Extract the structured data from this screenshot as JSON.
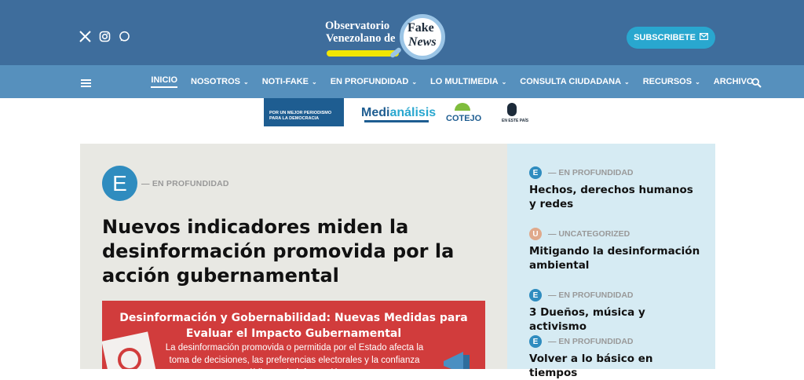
{
  "header": {
    "social": [
      "x-icon",
      "instagram-icon",
      "whatsapp-icon"
    ],
    "logo": {
      "line1": "Observatorio",
      "line2": "Venezolano de",
      "fake": "Fake",
      "news": "News"
    },
    "subscribe_label": "SUBSCRIBETE"
  },
  "nav": {
    "items": [
      {
        "label": "INICIO",
        "dropdown": false
      },
      {
        "label": "NOSOTROS",
        "dropdown": true
      },
      {
        "label": "NOTI-FAKE",
        "dropdown": true
      },
      {
        "label": "EN PROFUNDIDAD",
        "dropdown": true
      },
      {
        "label": "LO MULTIMEDIA",
        "dropdown": true
      },
      {
        "label": "CONSULTA CIUDADANA",
        "dropdown": true
      },
      {
        "label": "RECURSOS",
        "dropdown": true
      },
      {
        "label": "ARCHIVO",
        "dropdown": false
      }
    ]
  },
  "sponsors": {
    "s1": "POR UN MEJOR PERIODISMO PARA LA DEMOCRACIA",
    "s2a": "Medi",
    "s2b": "análisis",
    "s3": "COTEJO",
    "s4": "EN ESTE PAÍS"
  },
  "main": {
    "badge_letter": "E",
    "category": "— EN PROFUNDIDAD",
    "headline": "Nuevos indicadores miden la desinformación promovida por la acción gubernamental",
    "feature_title": "Desinformación y Gobernabilidad: Nuevas Medidas para Evaluar el Impacto Gubernamental",
    "feature_body": "La desinformación promovida o permitida por el Estado afecta la toma de decisiones, las preferencias electorales y la confianza pública en la información."
  },
  "sidebar": {
    "items": [
      {
        "letter": "E",
        "color": "#2f8cbf",
        "category": "— EN PROFUNDIDAD",
        "title": "Hechos, derechos humanos y redes"
      },
      {
        "letter": "U",
        "color": "#e0a98b",
        "category": "— UNCATEGORIZED",
        "title": "Mitigando la desinformación ambiental"
      },
      {
        "letter": "E",
        "color": "#2f8cbf",
        "category": "— EN PROFUNDIDAD",
        "title": "3 Dueños, música y activismo"
      },
      {
        "letter": "E",
        "color": "#2f8cbf",
        "category": "— EN PROFUNDIDAD",
        "title": "Volver a lo básico en tiempos"
      }
    ]
  }
}
